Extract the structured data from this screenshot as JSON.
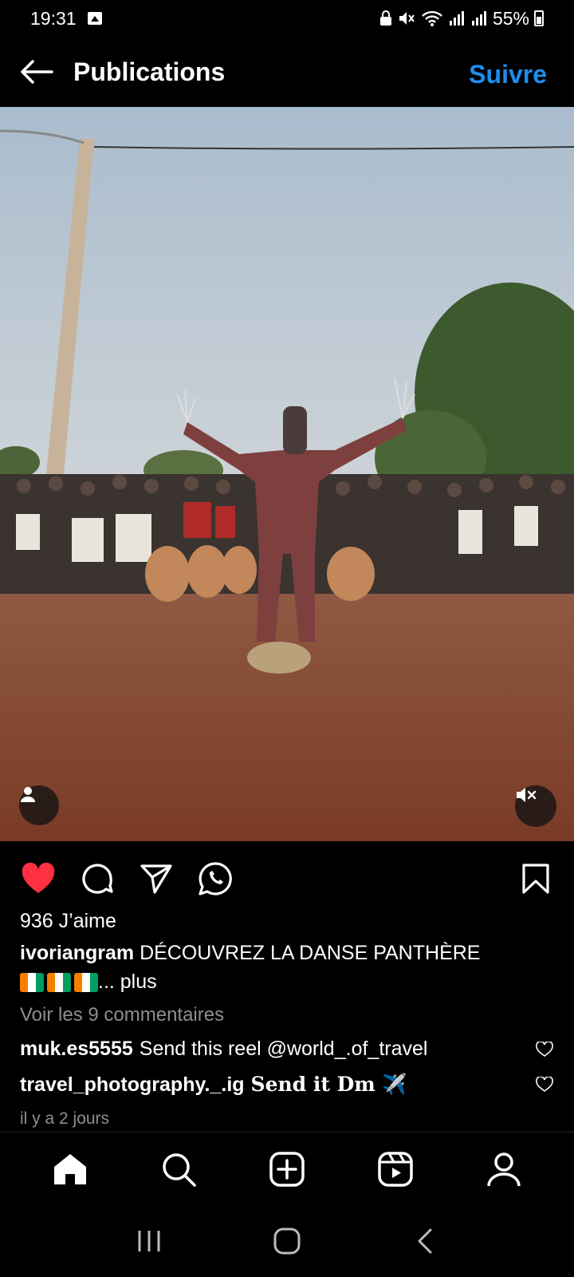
{
  "status_bar": {
    "time": "19:31",
    "battery_percent": "55%",
    "icons": [
      "gallery-icon",
      "lock-icon",
      "mute-icon",
      "wifi-icon",
      "signal-icon",
      "signal-icon",
      "battery-icon"
    ]
  },
  "header": {
    "title": "Publications",
    "follow_label": "Suivre",
    "accent_color": "#1d8ef0"
  },
  "post": {
    "media_description_icons": [
      "user-tag-icon",
      "volume-muted-icon"
    ],
    "liked": true,
    "like_color": "#ff3040",
    "likes_text": "936 J’aime",
    "author": "ivoriangram",
    "caption_text": "DÉCOUVREZ LA DANSE PANTHÈRE",
    "caption_more": "... plus",
    "flag_count": 3,
    "flag_colors": [
      "#f77f00",
      "#ffffff",
      "#009e60"
    ],
    "view_comments": "Voir les 9 commentaires",
    "comments": [
      {
        "user": "muk.es5555",
        "text": "Send this reel  @world_.of_travel"
      },
      {
        "user": "travel_photography._.ig",
        "text": "Send it Dm ✈️"
      }
    ],
    "timestamp": "il y a 2 jours"
  },
  "tab_bar": {
    "items": [
      "home-icon",
      "search-icon",
      "create-icon",
      "reels-icon",
      "profile-icon"
    ]
  },
  "system_nav": {
    "items": [
      "recent-apps-icon",
      "home-button-icon",
      "back-button-icon"
    ]
  }
}
